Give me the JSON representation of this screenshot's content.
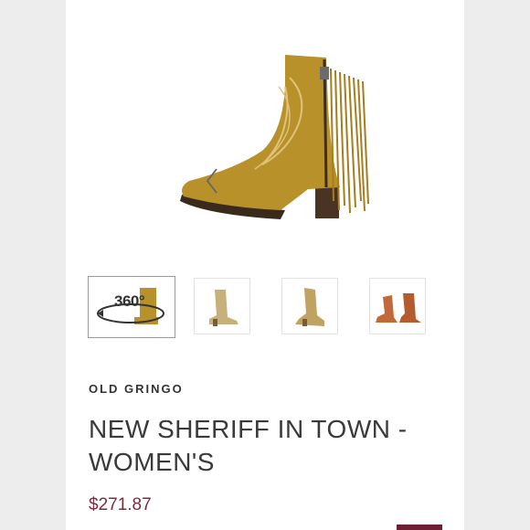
{
  "product": {
    "brand": "OLD GRINGO",
    "title": "NEW SHERIFF IN TOWN - WOMEN'S",
    "price": "$271.87"
  },
  "gallery": {
    "thumb_360_label": "360°",
    "thumbnails": [
      "360-view",
      "side-view-tan",
      "angled-view-tan",
      "pair-view-cognac"
    ]
  },
  "colors": {
    "accent": "#7c2b3d",
    "boot_tan": "#b8912a",
    "boot_stitch": "#e0c27a",
    "cognac": "#c06a3a"
  },
  "icons": {
    "expand": "expand-icon",
    "prev": "chevron-left-icon",
    "next": "chevron-right-icon"
  }
}
